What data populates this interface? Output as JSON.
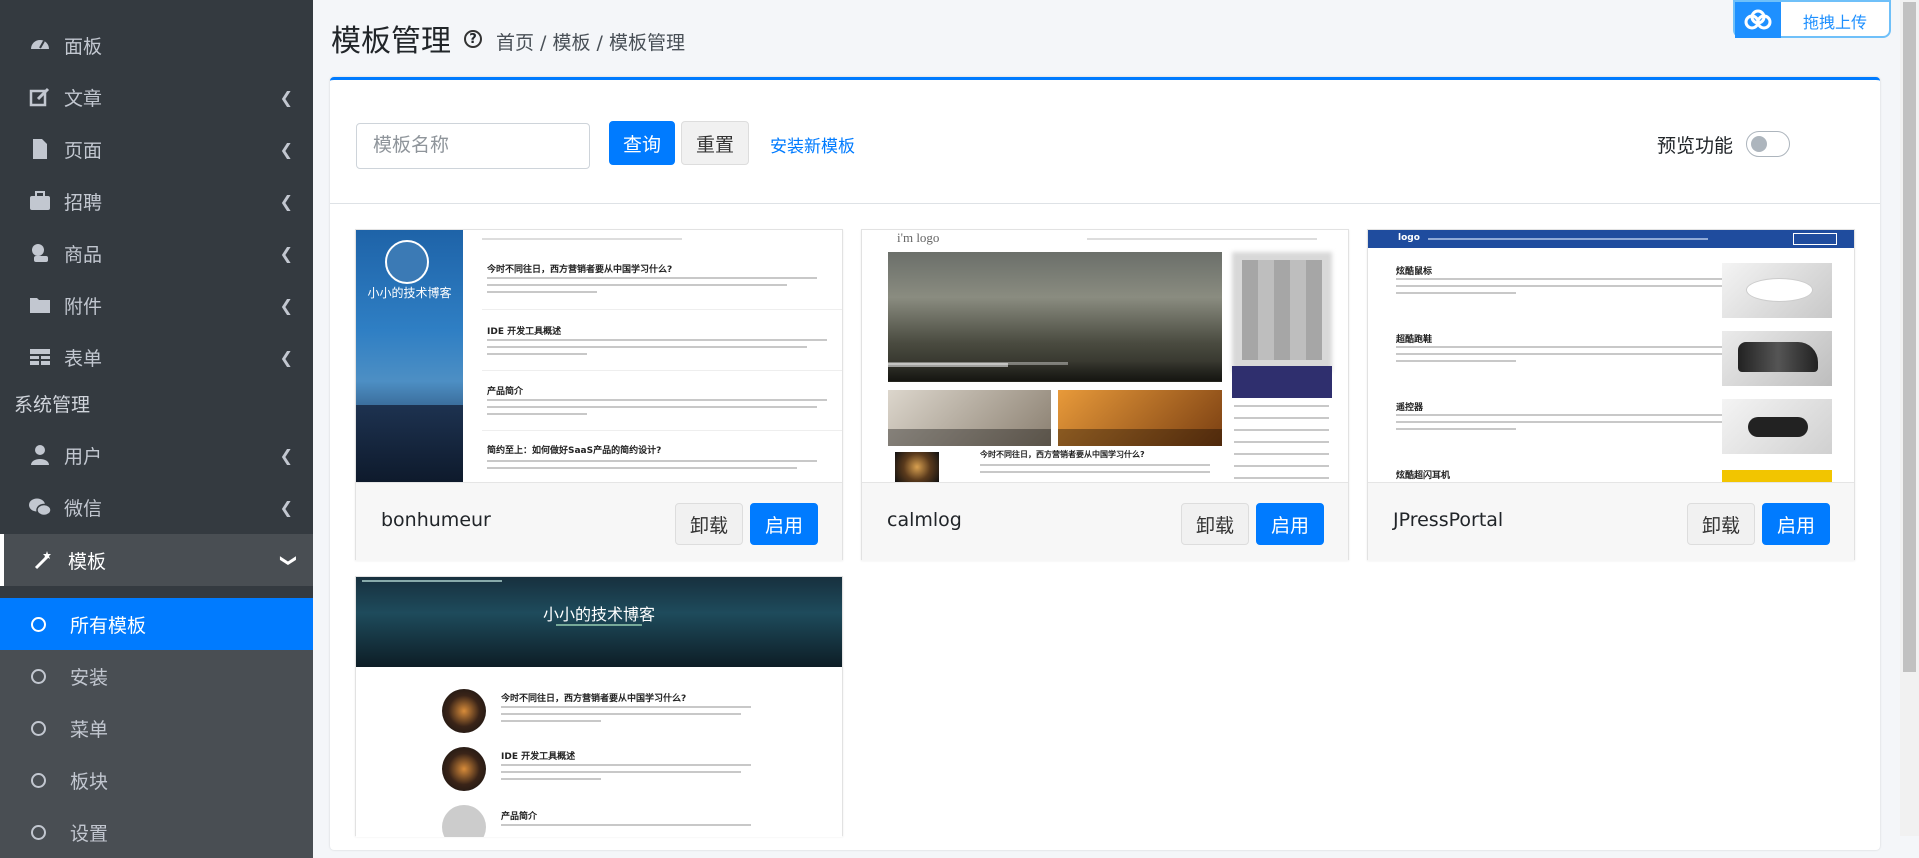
{
  "sidebar": {
    "items": [
      {
        "label": "面板",
        "icon": "dashboard-icon",
        "chevron": false
      },
      {
        "label": "文章",
        "icon": "edit-icon",
        "chevron": true
      },
      {
        "label": "页面",
        "icon": "file-icon",
        "chevron": true
      },
      {
        "label": "招聘",
        "icon": "briefcase-icon",
        "chevron": true
      },
      {
        "label": "商品",
        "icon": "shopping-icon",
        "chevron": true
      },
      {
        "label": "附件",
        "icon": "folder-icon",
        "chevron": true
      },
      {
        "label": "表单",
        "icon": "table-icon",
        "chevron": true
      }
    ],
    "section_header": "系统管理",
    "system_items": [
      {
        "label": "用户",
        "icon": "user-icon",
        "chevron": true
      },
      {
        "label": "微信",
        "icon": "wechat-icon",
        "chevron": true
      },
      {
        "label": "模板",
        "icon": "magic-icon",
        "chevron": true
      }
    ],
    "sub_items": [
      {
        "label": "所有模板",
        "active": true
      },
      {
        "label": "安装",
        "active": false
      },
      {
        "label": "菜单",
        "active": false
      },
      {
        "label": "板块",
        "active": false
      },
      {
        "label": "设置",
        "active": false
      }
    ]
  },
  "header": {
    "title": "模板管理",
    "breadcrumb": "首页 / 模板 / 模板管理",
    "upload_label": "拖拽上传"
  },
  "toolbar": {
    "search_placeholder": "模板名称",
    "query_label": "查询",
    "reset_label": "重置",
    "install_link": "安装新模板",
    "preview_label": "预览功能"
  },
  "templates": [
    {
      "name": "bonhumeur",
      "uninstall_label": "卸载",
      "enable_label": "启用"
    },
    {
      "name": "calmlog",
      "uninstall_label": "卸载",
      "enable_label": "启用"
    },
    {
      "name": "JPressPortal",
      "uninstall_label": "卸载",
      "enable_label": "启用"
    }
  ],
  "thumbs": {
    "bonhumeur": {
      "blog_title": "小小的技术博客",
      "posts": [
        "今时不同往日，西方营销者要从中国学习什么?",
        "IDE 开发工具概述",
        "产品简介",
        "简约至上：如何做好SaaS产品的简约设计?"
      ]
    },
    "calmlog": {
      "logo": "i'm logo",
      "post": "今时不同往日，西方营销者要从中国学习什么?"
    },
    "portal": {
      "logo": "logo",
      "posts": [
        "炫酷鼠标",
        "超酷跑鞋",
        "遥控器",
        "炫酷超闪耳机"
      ]
    },
    "fourth": {
      "blog_title": "小小的技术博客",
      "posts": [
        "今时不同往日，西方营销者要从中国学习什么?",
        "IDE 开发工具概述",
        "产品简介"
      ]
    }
  },
  "colors": {
    "primary": "#007bff",
    "sidebar": "#343a40"
  }
}
